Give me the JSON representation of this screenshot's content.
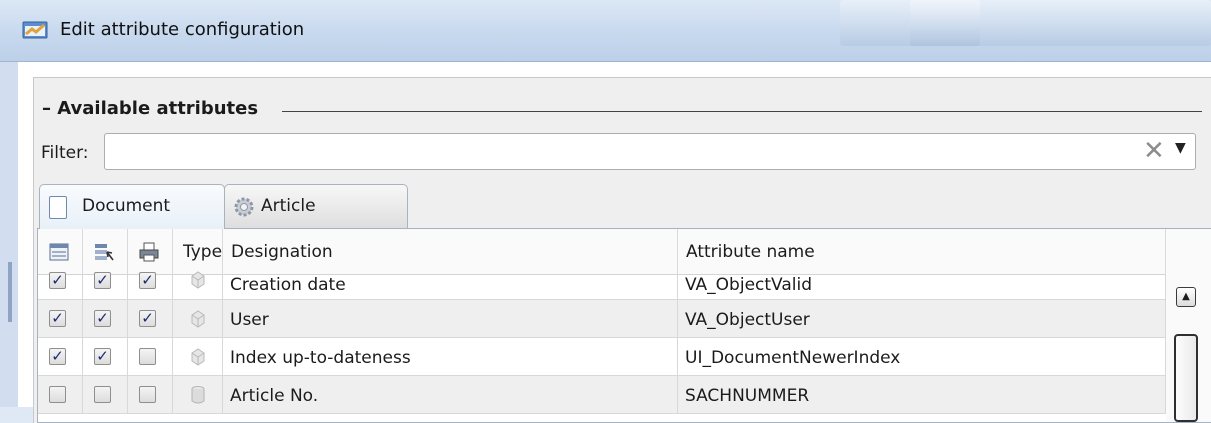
{
  "window": {
    "title": "Edit attribute configuration",
    "icon": "app-window-icon"
  },
  "group": {
    "title": "– Available attributes"
  },
  "filter": {
    "label": "Filter:",
    "value": "",
    "placeholder": "",
    "clear_icon": "clear-x-icon",
    "dropdown_icon": "dropdown-arrow-icon"
  },
  "tabs": [
    {
      "label": "Document",
      "icon": "document-icon",
      "active": true
    },
    {
      "label": "Article",
      "icon": "gear-icon",
      "active": false
    }
  ],
  "table": {
    "columns": [
      {
        "label": "",
        "icon": "list-column-icon"
      },
      {
        "label": "",
        "icon": "select-column-icon"
      },
      {
        "label": "",
        "icon": "print-column-icon"
      },
      {
        "label": "Type"
      },
      {
        "label": "Designation"
      },
      {
        "label": "Attribute name"
      }
    ],
    "rows": [
      {
        "c1": true,
        "c2": true,
        "c3": true,
        "type_icon": "system-attribute-icon",
        "designation": "Creation date",
        "attribute": "VA_ObjectValid"
      },
      {
        "c1": true,
        "c2": true,
        "c3": true,
        "type_icon": "system-attribute-icon",
        "designation": "User",
        "attribute": "VA_ObjectUser"
      },
      {
        "c1": true,
        "c2": true,
        "c3": false,
        "type_icon": "system-attribute-icon",
        "designation": "Index up-to-dateness",
        "attribute": "UI_DocumentNewerIndex"
      },
      {
        "c1": false,
        "c2": false,
        "c3": false,
        "type_icon": "database-attribute-icon",
        "designation": "Article No.",
        "attribute": "SACHNUMMER"
      }
    ]
  },
  "colors": {
    "titlebar": "#c8d9ee",
    "checkmark": "#1e2a6e",
    "alt_row": "#efefef"
  }
}
